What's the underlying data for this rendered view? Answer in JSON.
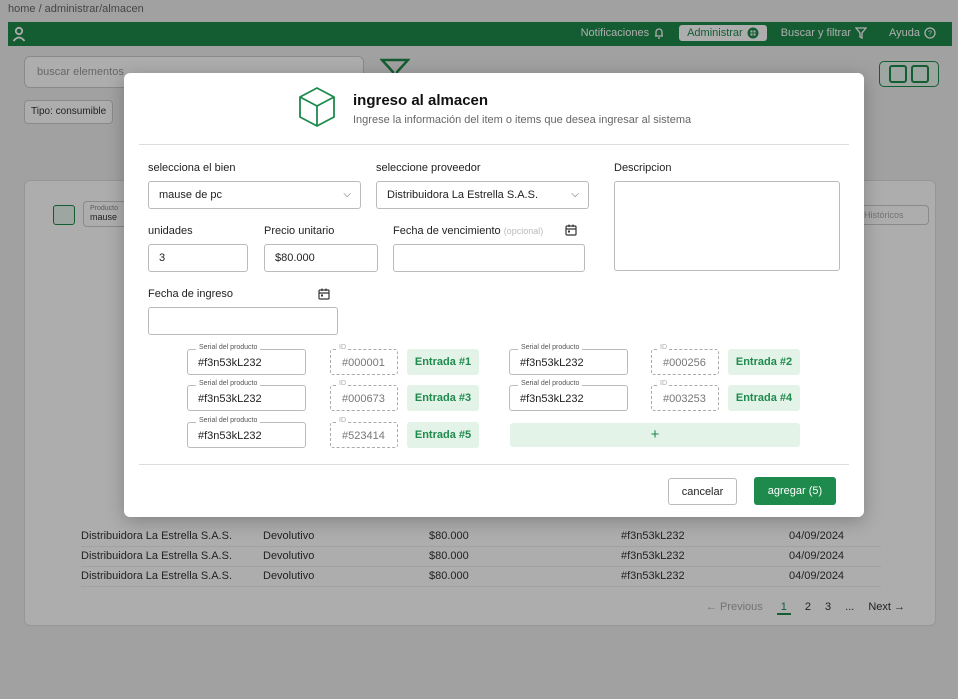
{
  "breadcrumb": "home / administrar/almacen",
  "topnav": [
    {
      "label": "Notificaciones",
      "icon": "bell-icon",
      "active": false
    },
    {
      "label": "Administrar",
      "icon": "grid-icon",
      "active": true
    },
    {
      "label": "Buscar y filtrar",
      "icon": "filter-icon",
      "active": false
    },
    {
      "label": "Ayuda",
      "icon": "help-icon",
      "active": false
    }
  ],
  "background": {
    "search_placeholder": "buscar elementos",
    "tipo_label": "Tipo: consumible",
    "producto_label": "Producto",
    "producto_value": "mause",
    "right_button": "Históricos",
    "rows": [
      {
        "proveedor": "Distribuidora La Estrella S.A.S.",
        "tipo": "Devolutivo",
        "precio": "$80.000",
        "serial": "#f3n53kL232",
        "fecha": "04/09/2024"
      },
      {
        "proveedor": "Distribuidora La Estrella S.A.S.",
        "tipo": "Devolutivo",
        "precio": "$80.000",
        "serial": "#f3n53kL232",
        "fecha": "04/09/2024"
      },
      {
        "proveedor": "Distribuidora La Estrella S.A.S.",
        "tipo": "Devolutivo",
        "precio": "$80.000",
        "serial": "#f3n53kL232",
        "fecha": "04/09/2024"
      }
    ],
    "pager": {
      "previous": "← Previous",
      "pages": [
        "1",
        "2",
        "3",
        "..."
      ],
      "next": "Next →"
    }
  },
  "modal": {
    "title": "ingreso al almacen",
    "subtitle": "Ingrese la información del item o items que desea ingresar al sistema",
    "bien_label": "selecciona el bien",
    "bien_value": "mause de pc",
    "proveedor_label": "seleccione proveedor",
    "proveedor_value": "Distribuidora La Estrella S.A.S.",
    "descripcion_label": "Descripcion",
    "unidades_label": "unidades",
    "unidades_value": "3",
    "precio_label": "Precio unitario",
    "precio_value": "$80.000",
    "vencimiento_label": "Fecha de vencimiento",
    "vencimiento_optional": "(opcional)",
    "ingreso_label": "Fecha de ingreso",
    "serial_legend": "Serial del producto",
    "id_legend": "ID",
    "entries": [
      {
        "serial": "#f3n53kL232",
        "id": "#000001",
        "label": "Entrada #1"
      },
      {
        "serial": "#f3n53kL232",
        "id": "#000256",
        "label": "Entrada #2"
      },
      {
        "serial": "#f3n53kL232",
        "id": "#000673",
        "label": "Entrada #3"
      },
      {
        "serial": "#f3n53kL232",
        "id": "#003253",
        "label": "Entrada #4"
      },
      {
        "serial": "#f3n53kL232",
        "id": "#523414",
        "label": "Entrada #5"
      }
    ],
    "add_entry": "+",
    "cancel_label": "cancelar",
    "submit_label": "agregar (5)"
  },
  "colors": {
    "accent": "#1e8a4c",
    "accent_light": "#e4f3e8"
  }
}
